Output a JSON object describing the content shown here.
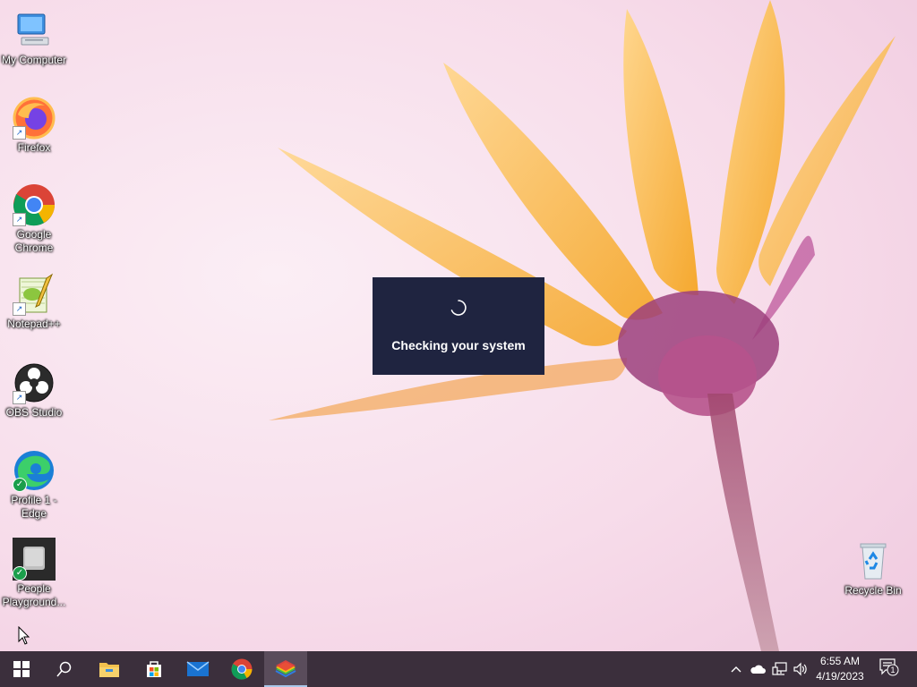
{
  "desktop": {
    "icons": [
      {
        "label": "My Computer",
        "icon": "computer-icon"
      },
      {
        "label": "Firefox",
        "icon": "firefox-icon"
      },
      {
        "label": "Google Chrome",
        "icon": "chrome-icon"
      },
      {
        "label": "Notepad++",
        "icon": "notepadpp-icon"
      },
      {
        "label": "OBS Studio",
        "icon": "obs-icon"
      },
      {
        "label": "Profile 1 - Edge",
        "icon": "edge-icon"
      },
      {
        "label": "People Playground...",
        "icon": "people-playground-icon"
      },
      {
        "label": "Recycle Bin",
        "icon": "recycle-bin-icon"
      }
    ]
  },
  "dialog": {
    "message": "Checking your system"
  },
  "taskbar": {
    "pinned": [
      {
        "name": "start",
        "icon": "windows-logo-icon"
      },
      {
        "name": "search",
        "icon": "search-icon"
      },
      {
        "name": "file-explorer",
        "icon": "folder-icon"
      },
      {
        "name": "microsoft-store",
        "icon": "store-icon"
      },
      {
        "name": "mail",
        "icon": "mail-icon"
      },
      {
        "name": "chrome",
        "icon": "chrome-icon"
      },
      {
        "name": "bluestacks",
        "icon": "bluestacks-icon",
        "active": true
      }
    ],
    "tray": {
      "time": "6:55 AM",
      "date": "4/19/2023",
      "notification_count": "1"
    }
  },
  "colors": {
    "taskbar": "#3b2f3c",
    "dialog": "#1f2440",
    "accent": "#a9c7ea"
  }
}
